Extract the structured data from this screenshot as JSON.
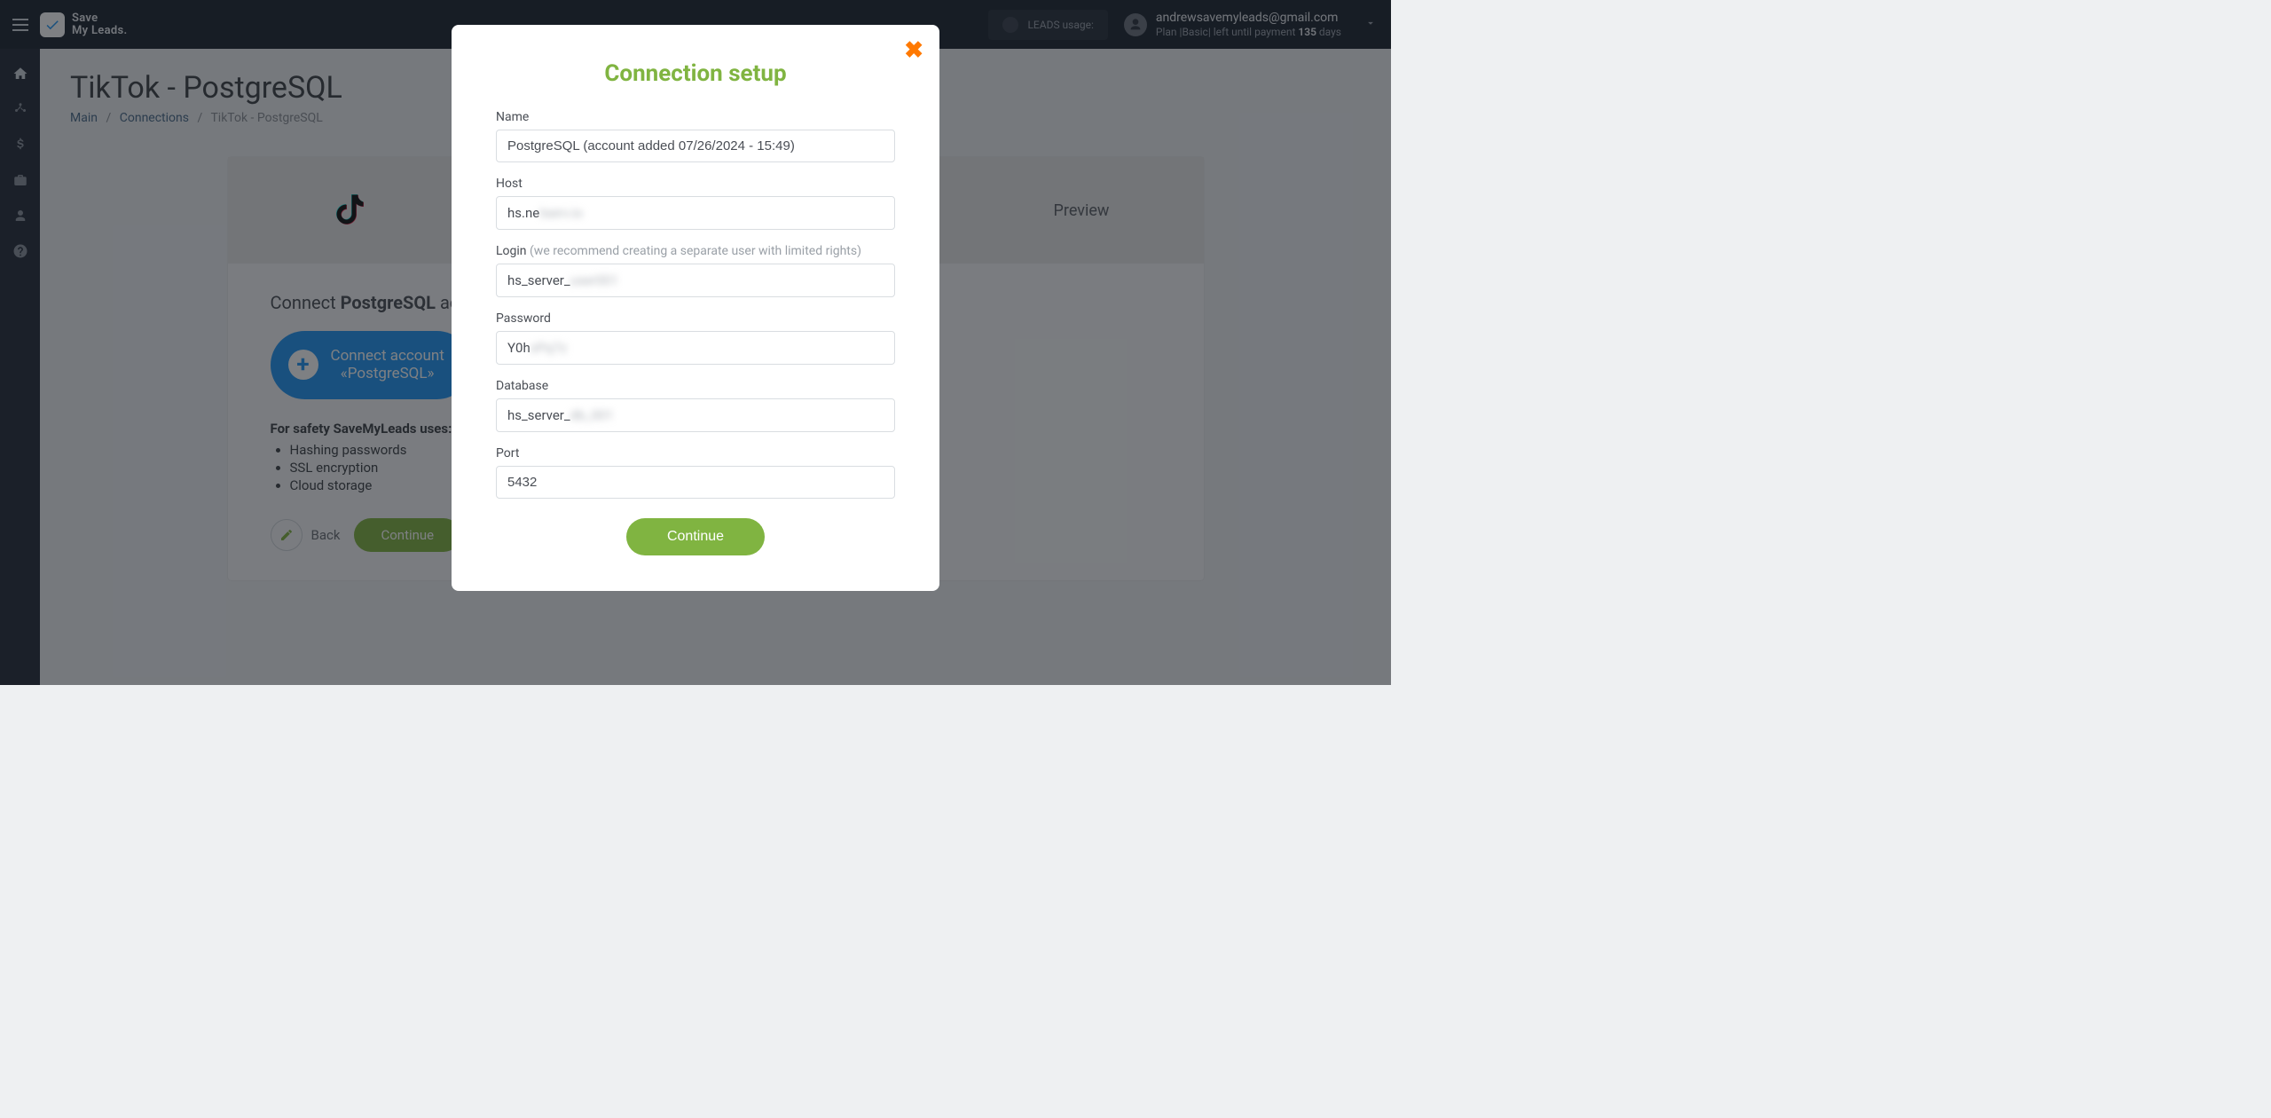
{
  "brand": {
    "name": "Save\nMy Leads."
  },
  "leads_usage_label": "LEADS usage:",
  "account": {
    "email": "andrewsavemyleads@gmail.com",
    "plan_prefix": "Plan |Basic| left until payment ",
    "days": "135",
    "days_suffix": " days"
  },
  "page": {
    "title": "TikTok - PostgreSQL",
    "breadcrumbs": {
      "main": "Main",
      "connections": "Connections",
      "current": "TikTok - PostgreSQL"
    }
  },
  "steps": {
    "preview": "Preview"
  },
  "card": {
    "connect_head_pre": "Connect ",
    "connect_head_strong": "PostgreSQL",
    "connect_head_post": " account",
    "connect_btn_line1": "Connect account",
    "connect_btn_line2": "«PostgreSQL»",
    "safety_intro": "For safety SaveMyLeads uses:",
    "safety_items": [
      "Hashing passwords",
      "SSL encryption",
      "Cloud storage"
    ],
    "back": "Back",
    "continue": "Continue"
  },
  "modal": {
    "title": "Connection setup",
    "name_label": "Name",
    "name_value": "PostgreSQL (account added 07/26/2024 - 15:49)",
    "host_label": "Host",
    "host_clear": "hs.ne",
    "host_blur": "tserv.io",
    "login_label": "Login ",
    "login_hint": "(we recommend creating a separate user with limited rights)",
    "login_clear": "hs_server_",
    "login_blur": "user001",
    "password_label": "Password",
    "password_clear": "Y0h",
    "password_blur": "xPq7z",
    "database_label": "Database",
    "database_clear": "hs_server_",
    "database_blur": "db_001",
    "port_label": "Port",
    "port_value": "5432",
    "continue": "Continue"
  }
}
